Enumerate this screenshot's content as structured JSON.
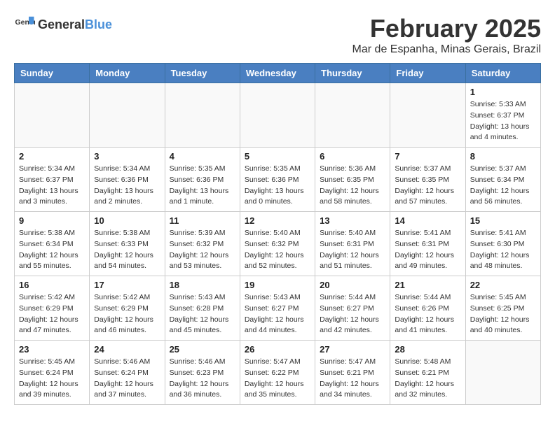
{
  "header": {
    "logo_general": "General",
    "logo_blue": "Blue",
    "month_title": "February 2025",
    "location": "Mar de Espanha, Minas Gerais, Brazil"
  },
  "days_of_week": [
    "Sunday",
    "Monday",
    "Tuesday",
    "Wednesday",
    "Thursday",
    "Friday",
    "Saturday"
  ],
  "weeks": [
    [
      {
        "day": "",
        "info": ""
      },
      {
        "day": "",
        "info": ""
      },
      {
        "day": "",
        "info": ""
      },
      {
        "day": "",
        "info": ""
      },
      {
        "day": "",
        "info": ""
      },
      {
        "day": "",
        "info": ""
      },
      {
        "day": "1",
        "info": "Sunrise: 5:33 AM\nSunset: 6:37 PM\nDaylight: 13 hours\nand 4 minutes."
      }
    ],
    [
      {
        "day": "2",
        "info": "Sunrise: 5:34 AM\nSunset: 6:37 PM\nDaylight: 13 hours\nand 3 minutes."
      },
      {
        "day": "3",
        "info": "Sunrise: 5:34 AM\nSunset: 6:36 PM\nDaylight: 13 hours\nand 2 minutes."
      },
      {
        "day": "4",
        "info": "Sunrise: 5:35 AM\nSunset: 6:36 PM\nDaylight: 13 hours\nand 1 minute."
      },
      {
        "day": "5",
        "info": "Sunrise: 5:35 AM\nSunset: 6:36 PM\nDaylight: 13 hours\nand 0 minutes."
      },
      {
        "day": "6",
        "info": "Sunrise: 5:36 AM\nSunset: 6:35 PM\nDaylight: 12 hours\nand 58 minutes."
      },
      {
        "day": "7",
        "info": "Sunrise: 5:37 AM\nSunset: 6:35 PM\nDaylight: 12 hours\nand 57 minutes."
      },
      {
        "day": "8",
        "info": "Sunrise: 5:37 AM\nSunset: 6:34 PM\nDaylight: 12 hours\nand 56 minutes."
      }
    ],
    [
      {
        "day": "9",
        "info": "Sunrise: 5:38 AM\nSunset: 6:34 PM\nDaylight: 12 hours\nand 55 minutes."
      },
      {
        "day": "10",
        "info": "Sunrise: 5:38 AM\nSunset: 6:33 PM\nDaylight: 12 hours\nand 54 minutes."
      },
      {
        "day": "11",
        "info": "Sunrise: 5:39 AM\nSunset: 6:32 PM\nDaylight: 12 hours\nand 53 minutes."
      },
      {
        "day": "12",
        "info": "Sunrise: 5:40 AM\nSunset: 6:32 PM\nDaylight: 12 hours\nand 52 minutes."
      },
      {
        "day": "13",
        "info": "Sunrise: 5:40 AM\nSunset: 6:31 PM\nDaylight: 12 hours\nand 51 minutes."
      },
      {
        "day": "14",
        "info": "Sunrise: 5:41 AM\nSunset: 6:31 PM\nDaylight: 12 hours\nand 49 minutes."
      },
      {
        "day": "15",
        "info": "Sunrise: 5:41 AM\nSunset: 6:30 PM\nDaylight: 12 hours\nand 48 minutes."
      }
    ],
    [
      {
        "day": "16",
        "info": "Sunrise: 5:42 AM\nSunset: 6:29 PM\nDaylight: 12 hours\nand 47 minutes."
      },
      {
        "day": "17",
        "info": "Sunrise: 5:42 AM\nSunset: 6:29 PM\nDaylight: 12 hours\nand 46 minutes."
      },
      {
        "day": "18",
        "info": "Sunrise: 5:43 AM\nSunset: 6:28 PM\nDaylight: 12 hours\nand 45 minutes."
      },
      {
        "day": "19",
        "info": "Sunrise: 5:43 AM\nSunset: 6:27 PM\nDaylight: 12 hours\nand 44 minutes."
      },
      {
        "day": "20",
        "info": "Sunrise: 5:44 AM\nSunset: 6:27 PM\nDaylight: 12 hours\nand 42 minutes."
      },
      {
        "day": "21",
        "info": "Sunrise: 5:44 AM\nSunset: 6:26 PM\nDaylight: 12 hours\nand 41 minutes."
      },
      {
        "day": "22",
        "info": "Sunrise: 5:45 AM\nSunset: 6:25 PM\nDaylight: 12 hours\nand 40 minutes."
      }
    ],
    [
      {
        "day": "23",
        "info": "Sunrise: 5:45 AM\nSunset: 6:24 PM\nDaylight: 12 hours\nand 39 minutes."
      },
      {
        "day": "24",
        "info": "Sunrise: 5:46 AM\nSunset: 6:24 PM\nDaylight: 12 hours\nand 37 minutes."
      },
      {
        "day": "25",
        "info": "Sunrise: 5:46 AM\nSunset: 6:23 PM\nDaylight: 12 hours\nand 36 minutes."
      },
      {
        "day": "26",
        "info": "Sunrise: 5:47 AM\nSunset: 6:22 PM\nDaylight: 12 hours\nand 35 minutes."
      },
      {
        "day": "27",
        "info": "Sunrise: 5:47 AM\nSunset: 6:21 PM\nDaylight: 12 hours\nand 34 minutes."
      },
      {
        "day": "28",
        "info": "Sunrise: 5:48 AM\nSunset: 6:21 PM\nDaylight: 12 hours\nand 32 minutes."
      },
      {
        "day": "",
        "info": ""
      }
    ]
  ]
}
